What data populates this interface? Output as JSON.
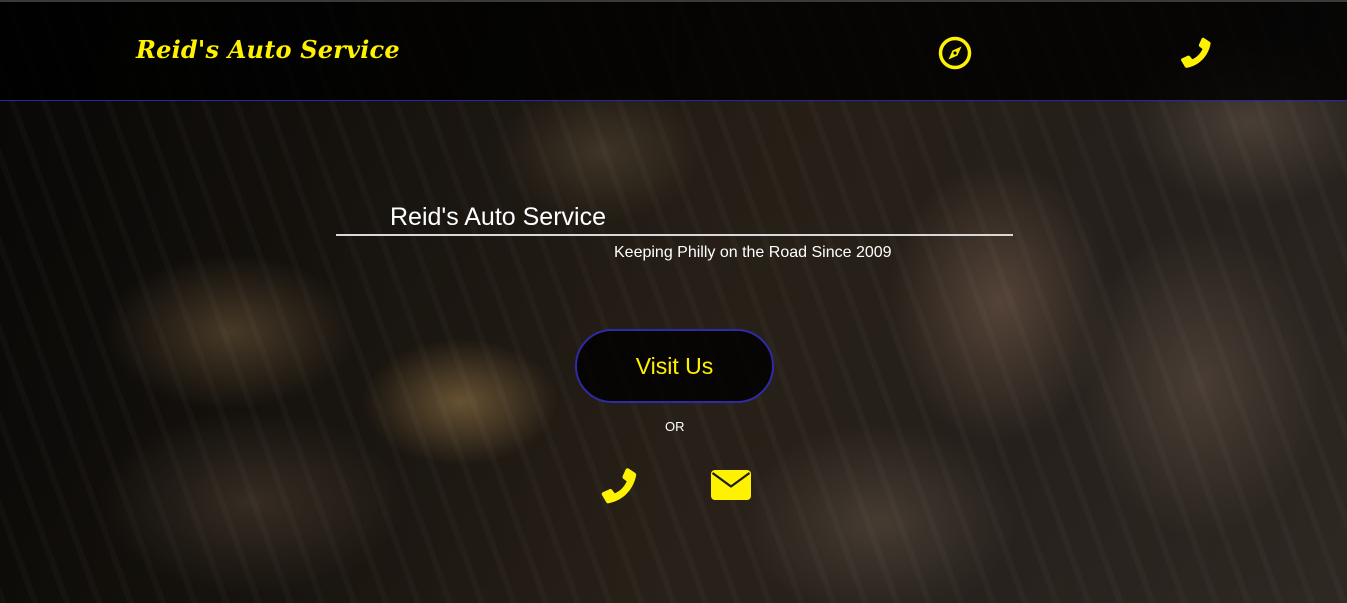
{
  "header": {
    "brand": "Reid's Auto Service",
    "nav_icons": [
      {
        "name": "compass-icon",
        "target": "directions"
      },
      {
        "name": "phone-icon",
        "target": "call"
      }
    ]
  },
  "hero": {
    "title": "Reid's Auto Service",
    "tagline": "Keeping Philly on the Road Since 2009",
    "cta_label": "Visit Us",
    "separator": "OR",
    "contact_icons": [
      "phone-icon",
      "envelope-icon"
    ]
  },
  "colors": {
    "accent": "#fff200",
    "border": "#2f2aa8",
    "text": "#ffffff",
    "header_bg": "#000000"
  }
}
